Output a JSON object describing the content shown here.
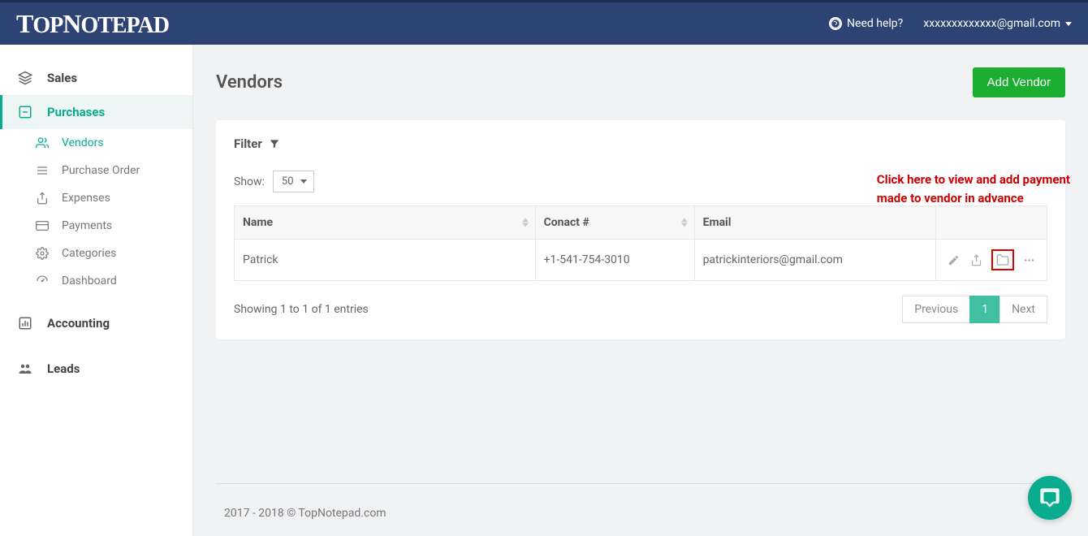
{
  "header": {
    "logo": "TopNotepad",
    "help": "Need help?",
    "user": "xxxxxxxxxxxxx@gmail.com"
  },
  "sidebar": {
    "sales": "Sales",
    "purchases": "Purchases",
    "vendors": "Vendors",
    "purchaseOrder": "Purchase Order",
    "expenses": "Expenses",
    "payments": "Payments",
    "categories": "Categories",
    "dashboard": "Dashboard",
    "accounting": "Accounting",
    "leads": "Leads"
  },
  "page": {
    "title": "Vendors",
    "addButton": "Add Vendor"
  },
  "filter": {
    "label": "Filter",
    "showLabel": "Show:",
    "showValue": "50"
  },
  "table": {
    "headers": {
      "name": "Name",
      "contact": "Conact #",
      "email": "Email"
    },
    "rows": [
      {
        "name": "Patrick",
        "contact": "+1-541-754-3010",
        "email": "patrickinteriors@gmail.com"
      }
    ]
  },
  "tableFooter": {
    "entries": "Showing 1 to 1 of 1 entries",
    "previous": "Previous",
    "page1": "1",
    "next": "Next"
  },
  "callout": {
    "line1": "Click here to view and add payment",
    "line2": "made to vendor in advance"
  },
  "footer": "2017 - 2018 © TopNotepad.com"
}
